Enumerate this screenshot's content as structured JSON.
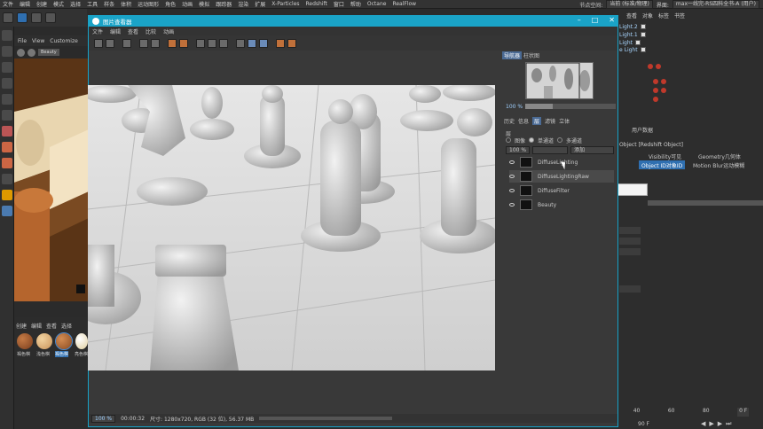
{
  "c4d": {
    "menu": [
      "文件",
      "编辑",
      "创建",
      "模式",
      "选择",
      "工具",
      "样条",
      "体积",
      "运动图形",
      "角色",
      "动画",
      "模拟",
      "跟踪器",
      "渲染",
      "扩展",
      "X-Particles",
      "Redshift",
      "窗口",
      "帮助",
      "Octane",
      "RealFlow"
    ],
    "top_right": {
      "node_space_label": "节点空间:",
      "node_space_value": "当前 (标准/物理)",
      "layout_label": "界面:",
      "layout_value": "max一线完-RS四科全书-A (用户)"
    },
    "viewport_menu": [
      "File",
      "View",
      "Customize"
    ],
    "viewport_mode": "Beauty",
    "material_menu": [
      "创建",
      "编辑",
      "查看",
      "选择"
    ],
    "materials": [
      {
        "label": "褐色棋",
        "color": "#7a3d1d"
      },
      {
        "label": "浅色棋",
        "color": "#c9935a"
      },
      {
        "label": "褐色棋",
        "color": "#8a4a20"
      },
      {
        "label": "亮色棋",
        "color": "#e0cfa0"
      }
    ],
    "object_tabs": [
      "查看",
      "对象",
      "标签",
      "书签"
    ],
    "objects": [
      "Light.2",
      "Light.1",
      "Light",
      "e Light"
    ],
    "attr_tabs": [
      "用户数据"
    ],
    "attr_title": "Object [Redshift Object]",
    "attr_buttons": {
      "visibility": "Visibility可见",
      "geometry": "Geometry几何体",
      "object_id": "Object ID对象ID",
      "motion_blur": "Motion Blur运动模糊"
    },
    "timeline": {
      "ticks": [
        "40",
        "60",
        "80",
        "0 F"
      ],
      "frame": "90 F"
    }
  },
  "picture_viewer": {
    "title": "图片查看器",
    "menu": [
      "文件",
      "编辑",
      "查看",
      "比较",
      "动画"
    ],
    "nav_tabs": [
      "导航器",
      "柱状图"
    ],
    "zoom": "100 %",
    "zoom_fraction": 0.3,
    "hist_tabs": [
      "历史",
      "信息",
      "层",
      "滤镜",
      "立体"
    ],
    "layer_heading": "层",
    "modes": [
      "图像",
      "单通道",
      "多通道"
    ],
    "active_mode": "单通道",
    "zoom2": "100 %",
    "blend": "添加",
    "layers": [
      {
        "name": "DiffuseLighting",
        "selected": false
      },
      {
        "name": "DiffuseLightingRaw",
        "selected": true
      },
      {
        "name": "DiffuseFilter",
        "selected": false
      },
      {
        "name": "Beauty",
        "selected": false
      }
    ],
    "status": {
      "zoom": "100 %",
      "time": "00:00:32",
      "info": "尺寸: 1280x720, RGB (32 位), 56.37 MB"
    }
  }
}
